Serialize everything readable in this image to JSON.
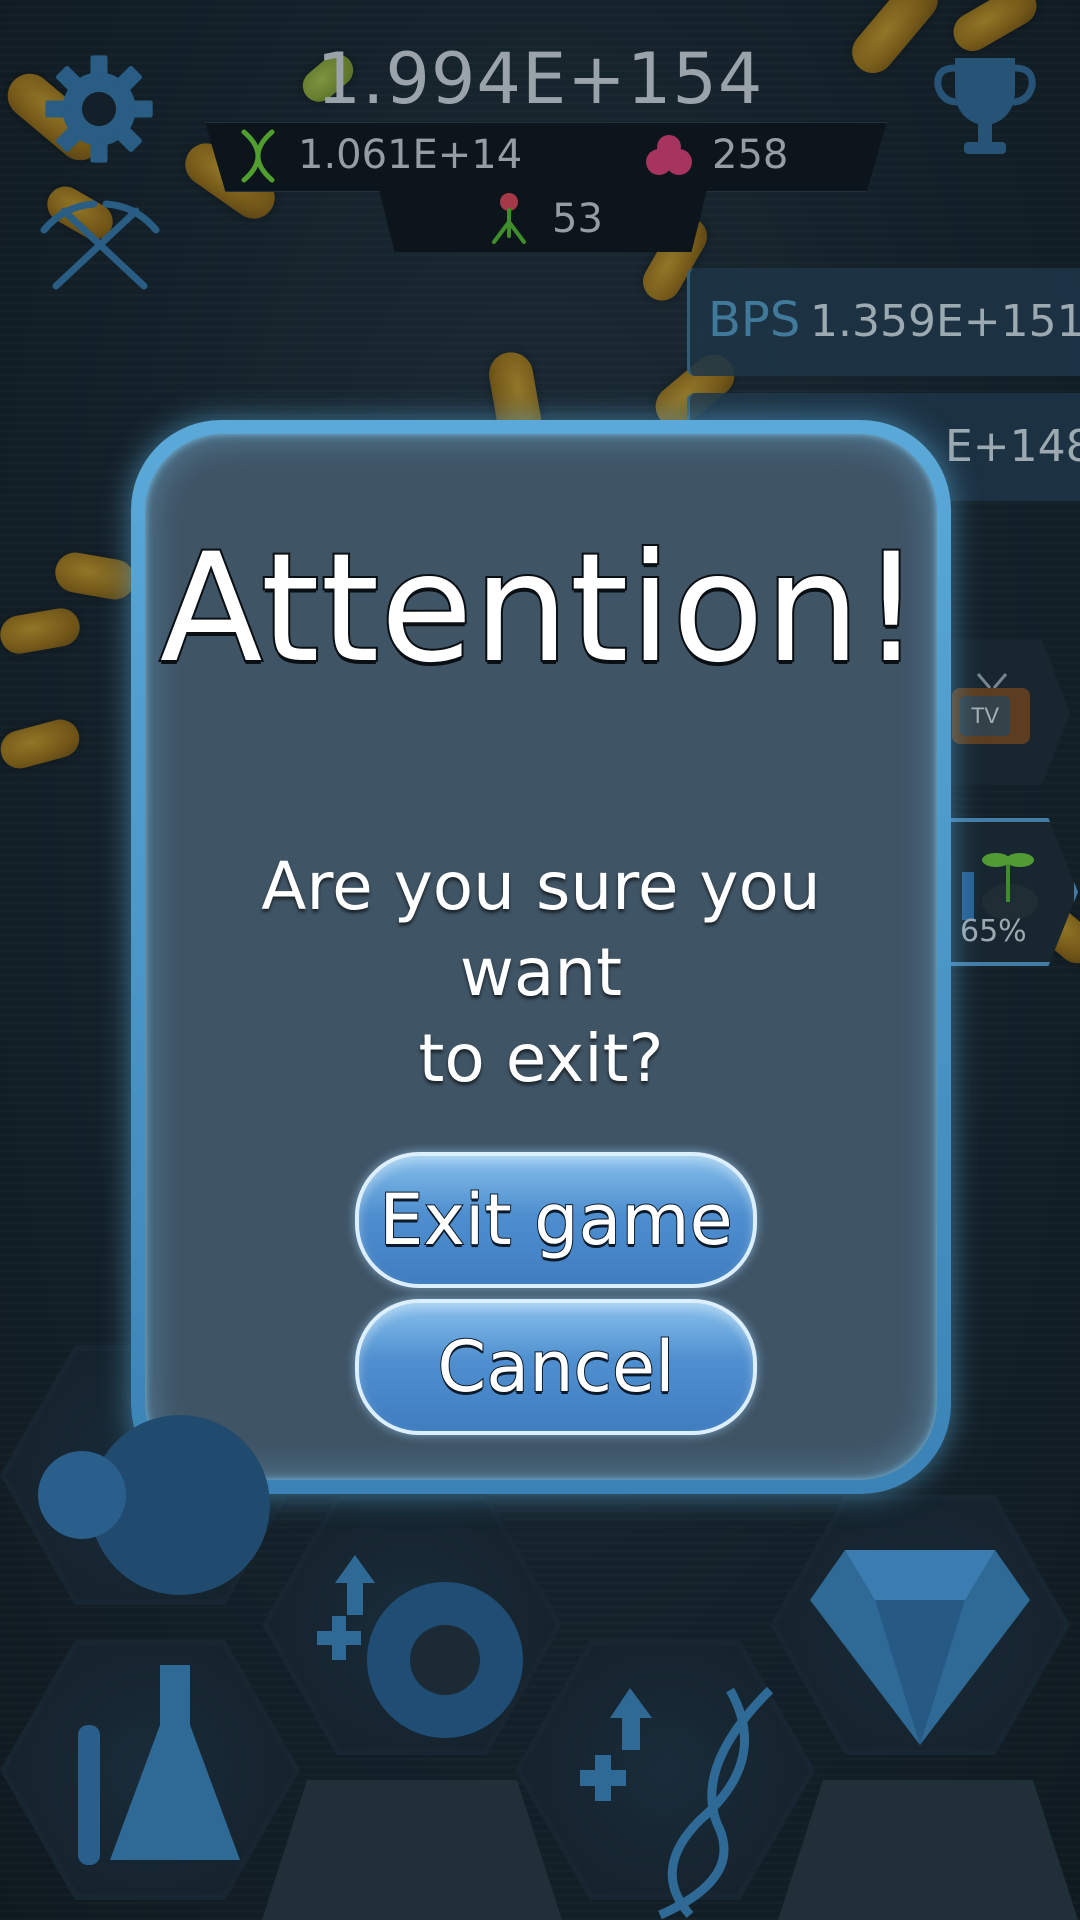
{
  "hud": {
    "main_count": "1.994E+154",
    "dna": "1.061E+14",
    "cells": "258",
    "viruses": "53"
  },
  "side": {
    "bps_label": "BPS",
    "bps_value": "1.359E+151",
    "second_value": "E+148",
    "boost_percent": "65%",
    "tv_label": "TV"
  },
  "dialog": {
    "title": "Attention!",
    "message_line1": "Are you sure you want",
    "message_line2": "to exit?",
    "exit_label": "Exit game",
    "cancel_label": "Cancel"
  },
  "colors": {
    "accent": "#4a8bb0",
    "dialog_border": "#5aa9d8",
    "dialog_fill": "#3f5465",
    "button": "#4f8fcf"
  },
  "icons": [
    "gear-icon",
    "pickaxes-icon",
    "trophy-icon",
    "dna-icon",
    "cell-cluster-icon",
    "virus-icon",
    "tv-icon",
    "sprout-icon",
    "flask-icon",
    "gear-upgrade-icon",
    "dna-upgrade-icon",
    "diamond-icon",
    "petri-dish-icon"
  ]
}
